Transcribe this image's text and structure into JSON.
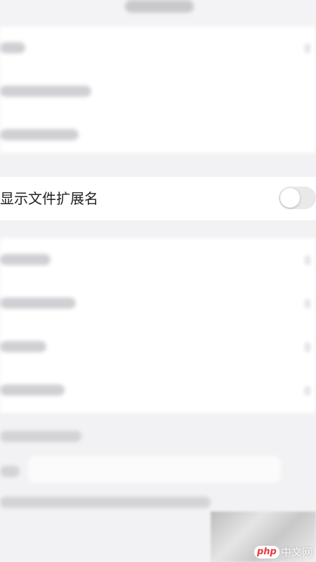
{
  "settings": {
    "show_file_extension": {
      "label": "显示文件扩展名",
      "enabled": false
    }
  },
  "watermark": {
    "logo_badge": "php",
    "logo_text": "中文网"
  },
  "colors": {
    "background": "#f2f2f4",
    "row_background": "#ffffff",
    "toggle_off": "#e9e9ea",
    "logo_accent": "#e8383d"
  }
}
